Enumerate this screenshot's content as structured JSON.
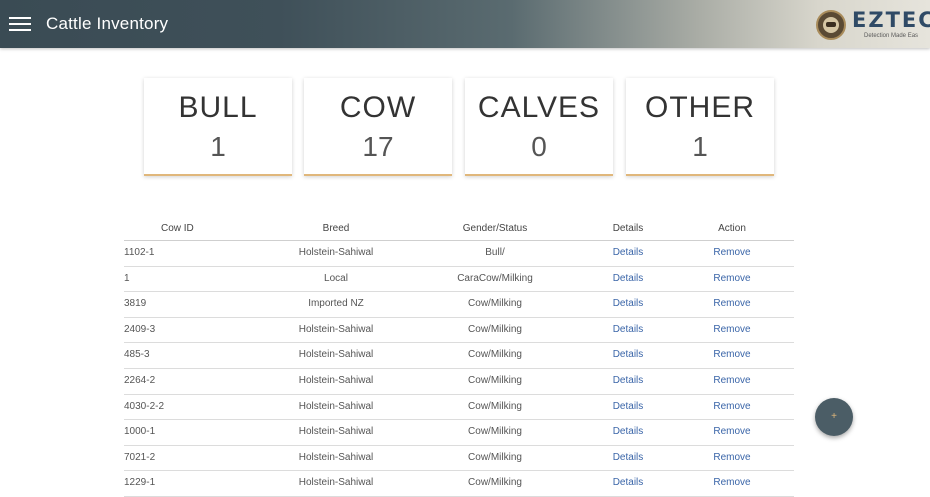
{
  "header": {
    "title": "Cattle Inventory",
    "logo_text": "EZTEC",
    "logo_tagline": "Detection Made Eas"
  },
  "stats": [
    {
      "label": "BULL",
      "value": "1"
    },
    {
      "label": "COW",
      "value": "17"
    },
    {
      "label": "CALVES",
      "value": "0"
    },
    {
      "label": "OTHER",
      "value": "1"
    }
  ],
  "table": {
    "columns": [
      "Cow ID",
      "Breed",
      "Gender/Status",
      "Details",
      "Action"
    ],
    "rows": [
      {
        "id": "1102-1",
        "breed": "Holstein-Sahiwal",
        "status": "Bull/",
        "details": "Details",
        "action": "Remove"
      },
      {
        "id": "1",
        "breed": "Local",
        "status": "CaraCow/Milking",
        "details": "Details",
        "action": "Remove"
      },
      {
        "id": "3819",
        "breed": "Imported NZ",
        "status": "Cow/Milking",
        "details": "Details",
        "action": "Remove"
      },
      {
        "id": "2409-3",
        "breed": "Holstein-Sahiwal",
        "status": "Cow/Milking",
        "details": "Details",
        "action": "Remove"
      },
      {
        "id": "485-3",
        "breed": "Holstein-Sahiwal",
        "status": "Cow/Milking",
        "details": "Details",
        "action": "Remove"
      },
      {
        "id": "2264-2",
        "breed": "Holstein-Sahiwal",
        "status": "Cow/Milking",
        "details": "Details",
        "action": "Remove"
      },
      {
        "id": "4030-2-2",
        "breed": "Holstein-Sahiwal",
        "status": "Cow/Milking",
        "details": "Details",
        "action": "Remove"
      },
      {
        "id": "1000-1",
        "breed": "Holstein-Sahiwal",
        "status": "Cow/Milking",
        "details": "Details",
        "action": "Remove"
      },
      {
        "id": "7021-2",
        "breed": "Holstein-Sahiwal",
        "status": "Cow/Milking",
        "details": "Details",
        "action": "Remove"
      },
      {
        "id": "1229-1",
        "breed": "Holstein-Sahiwal",
        "status": "Cow/Milking",
        "details": "Details",
        "action": "Remove"
      }
    ]
  },
  "fab": {
    "label": "+"
  },
  "colors": {
    "header_dark": "#3a4b54",
    "accent": "#e0b77b",
    "link": "#3a65a8"
  }
}
